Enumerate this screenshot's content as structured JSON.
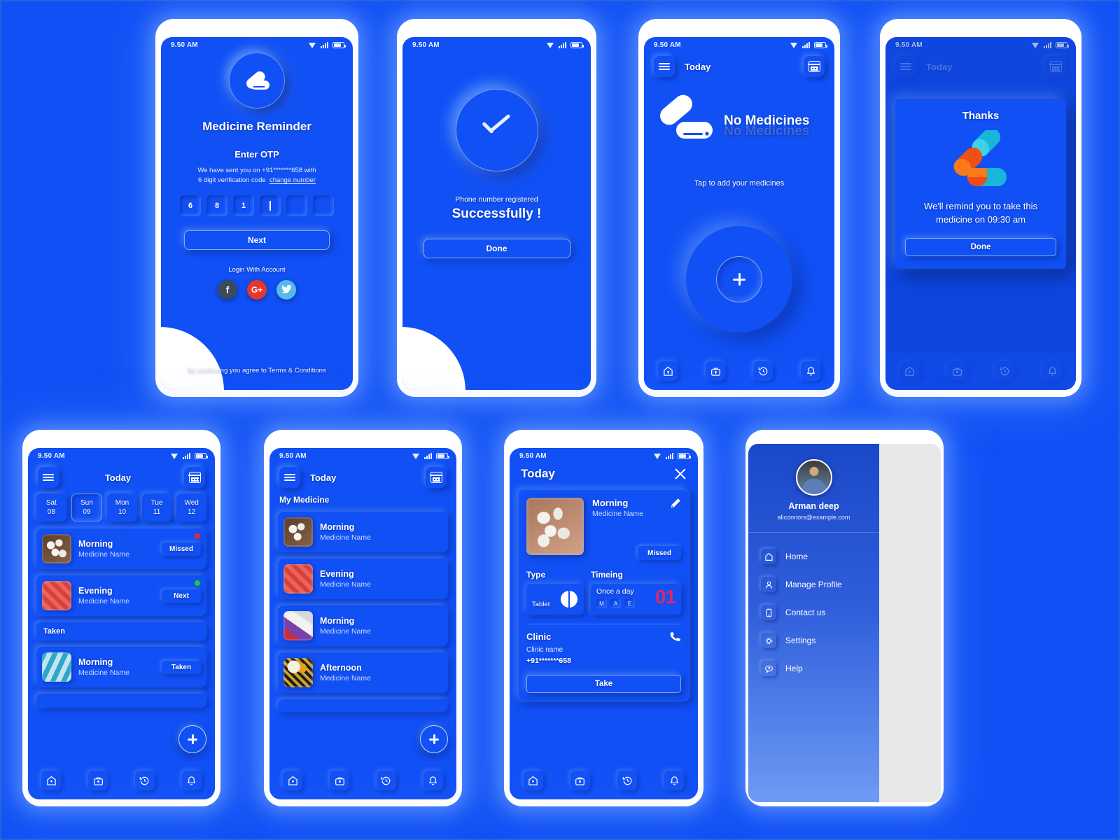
{
  "meta": {
    "bg_color": "#1150f5",
    "accent_white": "#ffffff"
  },
  "status_bar": {
    "time": "9.50 AM",
    "wifi_icon": "wifi-icon",
    "signal_icon": "signal-icon",
    "battery_icon": "battery-icon"
  },
  "screen1": {
    "app_title": "Medicine Reminder",
    "logo_icon": "capsule-icon",
    "section_title": "Enter OTP",
    "sub_line1": "We have sent you on +91*******658 with",
    "sub_line2": "6 digit verification code",
    "change_number": "change number",
    "otp": [
      "6",
      "8",
      "1",
      "",
      "",
      ""
    ],
    "next_label": "Next",
    "login_with": "Login With Account",
    "socials": [
      {
        "name": "facebook-icon",
        "glyph": "f",
        "color": "#3b4a5c"
      },
      {
        "name": "google-plus-icon",
        "glyph": "G+",
        "color": "#e5372b"
      },
      {
        "name": "twitter-icon",
        "glyph": "ᴠ",
        "color": "#56b8ec"
      }
    ],
    "terms": "By continuing you agree to Terms & Conditions"
  },
  "screen2": {
    "check_icon": "check-circle-icon",
    "line1": "Phone number registered",
    "line2": "Successfully !",
    "done_label": "Done"
  },
  "screen3": {
    "menu_icon": "hamburger-icon",
    "title": "Today",
    "calendar_icon": "calendar-icon",
    "empty_illustration": "two-capsules-icon",
    "empty_title": "No Medicines",
    "hint": "Tap to add your medicines",
    "fab_icon": "plus-icon",
    "nav": [
      {
        "name": "nav-home",
        "icon": "home-icon"
      },
      {
        "name": "nav-medkit",
        "icon": "medical-bag-icon"
      },
      {
        "name": "nav-history",
        "icon": "history-clock-icon"
      },
      {
        "name": "nav-alerts",
        "icon": "bell-icon"
      }
    ]
  },
  "screen4": {
    "title": "Today",
    "dialog_title": "Thanks",
    "dialog_illustration": "colored-capsules-icon",
    "dialog_text": "We'll remind you to take this medicine on 09:30 am",
    "done_label": "Done"
  },
  "screen5": {
    "menu_icon": "hamburger-icon",
    "calendar_icon": "calendar-icon",
    "today_label": "Today",
    "dates": [
      {
        "day": "Sat",
        "num": "08",
        "selected": false
      },
      {
        "day": "Sun",
        "num": "09",
        "selected": true
      },
      {
        "day": "Mon",
        "num": "10",
        "selected": false
      },
      {
        "day": "Tue",
        "num": "11",
        "selected": false
      },
      {
        "day": "Wed",
        "num": "12",
        "selected": false
      }
    ],
    "items": [
      {
        "title": "Morning",
        "name": "Medicine Name",
        "tag": "Missed",
        "dot": "#f0232d",
        "thumb": "white-capsules"
      },
      {
        "title": "Evening",
        "name": "Medicine Name",
        "tag": "Next",
        "dot": "#17d02c",
        "thumb": "red-blister"
      }
    ],
    "section_label": "Taken",
    "taken_items": [
      {
        "title": "Morning",
        "name": "Medicine Name",
        "tag": "Taken",
        "thumb": "blue-capsules"
      }
    ],
    "fab_icon": "plus-icon"
  },
  "screen6": {
    "title": "Today",
    "menu_icon": "hamburger-icon",
    "calendar_icon": "calendar-icon",
    "section_head": "My Medicine",
    "items": [
      {
        "title": "Morning",
        "name": "Medicine Name",
        "thumb": "white-pills"
      },
      {
        "title": "Evening",
        "name": "Medicine Name",
        "thumb": "red-blister"
      },
      {
        "title": "Morning",
        "name": "Medicine Name",
        "thumb": "mixed-pills"
      },
      {
        "title": "Afternoon",
        "name": "Medicine Name",
        "thumb": "capsule-grain"
      }
    ],
    "fab_icon": "plus-icon"
  },
  "screen7": {
    "title": "Today",
    "close_icon": "close-icon",
    "med_title": "Morning",
    "med_name": "Medicine Name",
    "edit_icon": "pencil-icon",
    "status_tag": "Missed",
    "type_label": "Type",
    "timing_label": "Timeing",
    "type_value": "Tablet",
    "type_icon": "half-circle-pill-icon",
    "timing_value": "Once a day",
    "timing_slots": [
      "M",
      "A",
      "E"
    ],
    "timing_count": "01",
    "timing_count_color": "#e8265f",
    "clinic_label": "Clinic",
    "clinic_name": "Clinic name",
    "clinic_phone": "+91*******658",
    "phone_icon": "phone-icon",
    "take_label": "Take"
  },
  "screen8": {
    "user_name": "Arman deep",
    "user_email": "aliconnors@example.com",
    "avatar_icon": "avatar",
    "items": [
      {
        "label": "Home",
        "icon": "home-icon"
      },
      {
        "label": "Manage Profile",
        "icon": "user-icon"
      },
      {
        "label": "Contact us",
        "icon": "contact-phone-icon"
      },
      {
        "label": "Settings",
        "icon": "gear-icon"
      },
      {
        "label": "Help",
        "icon": "help-chat-icon"
      }
    ]
  }
}
